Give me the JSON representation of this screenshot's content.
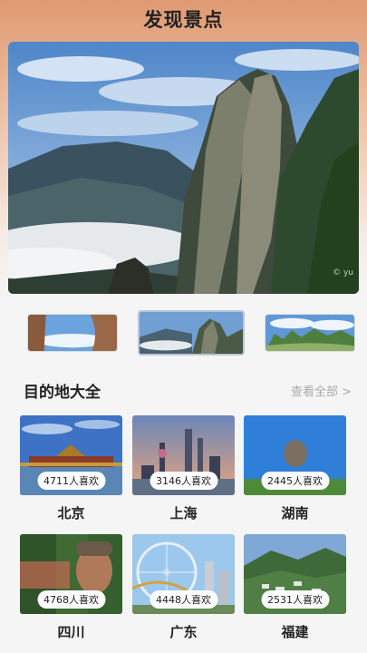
{
  "header": {
    "title": "发现景点"
  },
  "hero": {
    "watermark": "© yu"
  },
  "section": {
    "title": "目的地大全",
    "view_all": "查看全部 >"
  },
  "destinations": [
    {
      "name": "北京",
      "likes": "4711人喜欢"
    },
    {
      "name": "上海",
      "likes": "3146人喜欢"
    },
    {
      "name": "湖南",
      "likes": "2445人喜欢"
    },
    {
      "name": "四川",
      "likes": "4768人喜欢"
    },
    {
      "name": "广东",
      "likes": "4448人喜欢"
    },
    {
      "name": "福建",
      "likes": "2531人喜欢"
    }
  ]
}
